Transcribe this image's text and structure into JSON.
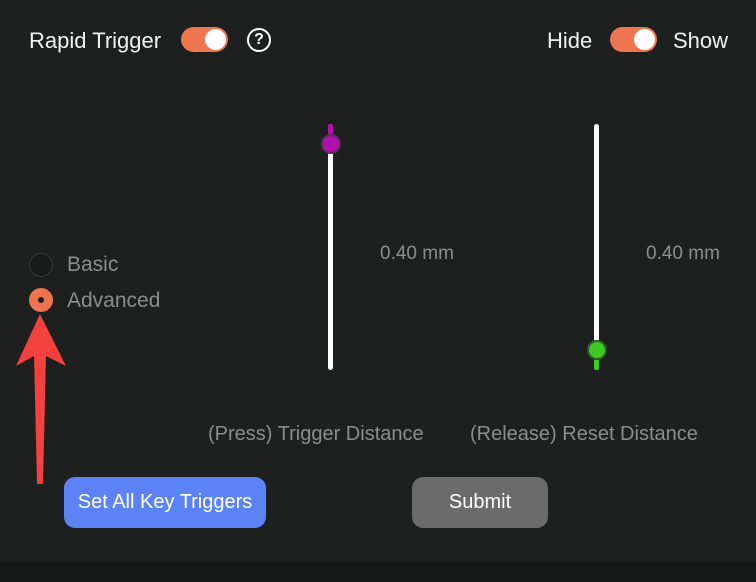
{
  "header": {
    "rapid_trigger_label": "Rapid Trigger",
    "rapid_trigger_on": true,
    "help_glyph": "?",
    "hide_label": "Hide",
    "show_label": "Show",
    "visibility_on": true
  },
  "mode": {
    "options": [
      {
        "label": "Basic",
        "selected": false
      },
      {
        "label": "Advanced",
        "selected": true
      }
    ]
  },
  "sliders": {
    "trigger": {
      "value_text": "0.40 mm",
      "label": "(Press) Trigger Distance",
      "level": 0.92,
      "thumb_color": "#b10fb0"
    },
    "reset": {
      "value_text": "0.40 mm",
      "label": "(Release) Reset Distance",
      "level": 0.08,
      "thumb_color": "#3ccb20"
    }
  },
  "actions": {
    "set_all_label": "Set All Key Triggers",
    "submit_label": "Submit"
  },
  "colors": {
    "background": "#1e1f1f",
    "accent_orange": "#ee7552",
    "button_blue": "#5b83f5",
    "button_gray": "#6b6b6b",
    "annotation_red": "#f2413f"
  },
  "icons": {
    "help": "help-circle-icon",
    "annotation": "red-arrow-icon"
  }
}
